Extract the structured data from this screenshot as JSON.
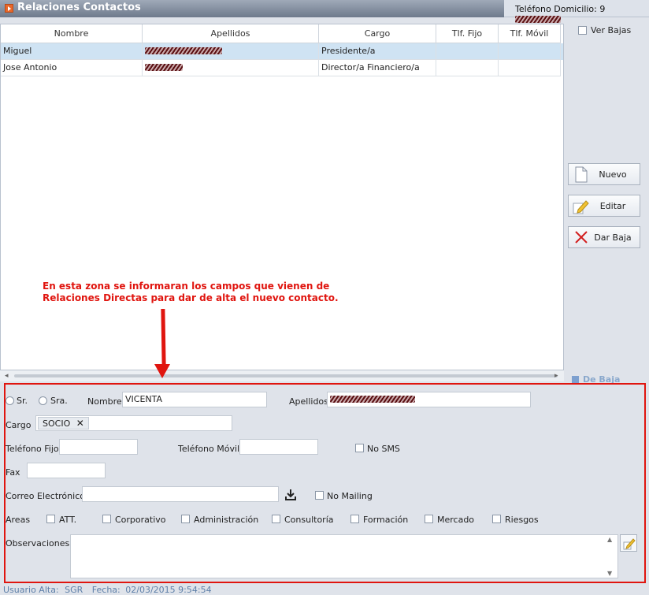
{
  "title": "Relaciones Contactos",
  "phone": {
    "label": "Teléfono Domicilio:",
    "value_prefix": "9"
  },
  "grid": {
    "columns": [
      "Nombre",
      "Apellidos",
      "Cargo",
      "Tlf. Fijo",
      "Tlf. Móvil"
    ],
    "rows": [
      {
        "nombre": "Miguel",
        "apellidos_visible": "",
        "cargo": "Presidente/a",
        "fijo": "",
        "movil": "",
        "selected": true
      },
      {
        "nombre": "Jose Antonio",
        "apellidos_visible": "",
        "cargo": "Director/a Financiero/a",
        "fijo": "",
        "movil": "",
        "selected": false
      }
    ]
  },
  "ver_bajas": "Ver Bajas",
  "buttons": {
    "nuevo": "Nuevo",
    "editar": "Editar",
    "dar_baja": "Dar Baja"
  },
  "note": {
    "line1": "En esta zona se informaran los campos que vienen de",
    "line2": "Relaciones Directas para dar de alta el nuevo contacto."
  },
  "de_baja": "De Baja",
  "form": {
    "sr": "Sr.",
    "sra": "Sra.",
    "nombre_label": "Nombre",
    "nombre_value": "VICENTA",
    "apellidos_label": "Apellidos",
    "cargo_label": "Cargo",
    "cargo_tag": "SOCIO",
    "tel_fijo_label": "Teléfono Fijo",
    "tel_movil_label": "Teléfono Móvil",
    "no_sms": "No SMS",
    "fax_label": "Fax",
    "correo_label": "Correo Electrónico",
    "no_mailing": "No Mailing",
    "areas_label": "Areas",
    "areas": [
      "ATT.",
      "Corporativo",
      "Administración",
      "Consultoría",
      "Formación",
      "Mercado",
      "Riesgos"
    ],
    "observaciones_label": "Observaciones"
  },
  "footer": {
    "usuario_label": "Usuario Alta:",
    "usuario": "SGR",
    "fecha_label": "Fecha:",
    "fecha": "02/03/2015 9:54:54"
  },
  "colors": {
    "red": "#e0150f",
    "accent": "#5e7fa8"
  }
}
